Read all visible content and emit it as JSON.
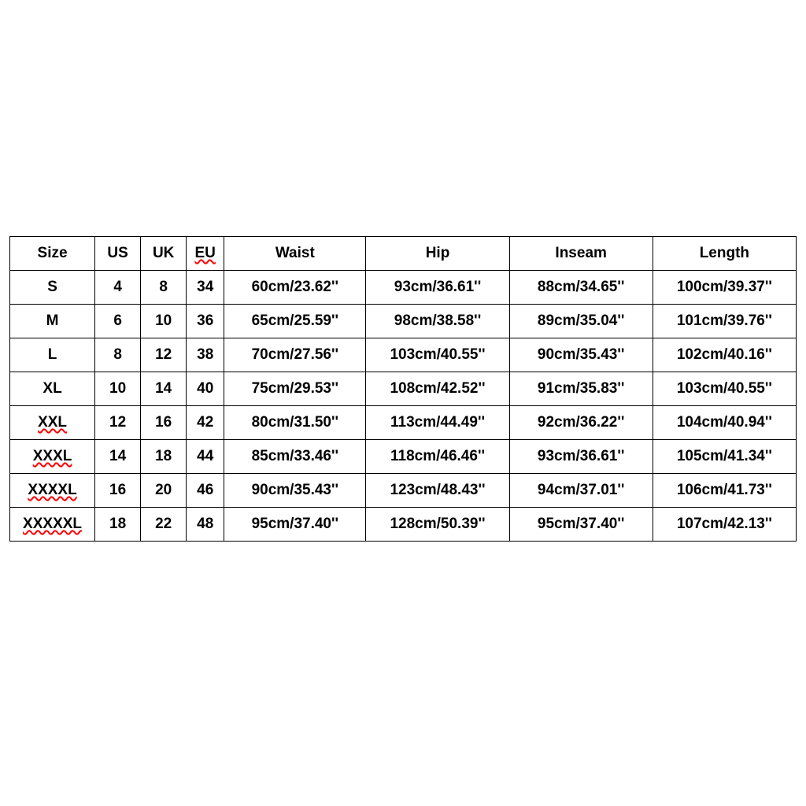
{
  "chart_data": {
    "type": "table",
    "columns": [
      "Size",
      "US",
      "UK",
      "EU",
      "Waist",
      "Hip",
      "Inseam",
      "Length"
    ],
    "rows": [
      [
        "S",
        "4",
        "8",
        "34",
        "60cm/23.62''",
        "93cm/36.61''",
        "88cm/34.65''",
        "100cm/39.37''"
      ],
      [
        "M",
        "6",
        "10",
        "36",
        "65cm/25.59''",
        "98cm/38.58''",
        "89cm/35.04''",
        "101cm/39.76''"
      ],
      [
        "L",
        "8",
        "12",
        "38",
        "70cm/27.56''",
        "103cm/40.55''",
        "90cm/35.43''",
        "102cm/40.16''"
      ],
      [
        "XL",
        "10",
        "14",
        "40",
        "75cm/29.53''",
        "108cm/42.52''",
        "91cm/35.83''",
        "103cm/40.55''"
      ],
      [
        "XXL",
        "12",
        "16",
        "42",
        "80cm/31.50''",
        "113cm/44.49''",
        "92cm/36.22''",
        "104cm/40.94''"
      ],
      [
        "XXXL",
        "14",
        "18",
        "44",
        "85cm/33.46''",
        "118cm/46.46''",
        "93cm/36.61''",
        "105cm/41.34''"
      ],
      [
        "XXXXL",
        "16",
        "20",
        "46",
        "90cm/35.43''",
        "123cm/48.43''",
        "94cm/37.01''",
        "106cm/41.73''"
      ],
      [
        "XXXXXL",
        "18",
        "22",
        "48",
        "95cm/37.40''",
        "128cm/50.39''",
        "95cm/37.40''",
        "107cm/42.13''"
      ]
    ]
  },
  "headers": {
    "size": {
      "label": "Size",
      "squiggle": false
    },
    "us": {
      "label": "US",
      "squiggle": false
    },
    "uk": {
      "label": "UK",
      "squiggle": false
    },
    "eu": {
      "label": "EU",
      "squiggle": true
    },
    "waist": {
      "label": "Waist",
      "squiggle": false
    },
    "hip": {
      "label": "Hip",
      "squiggle": false
    },
    "inseam": {
      "label": "Inseam",
      "squiggle": false
    },
    "length": {
      "label": "Length",
      "squiggle": false
    }
  },
  "rows": [
    {
      "size": {
        "v": "S",
        "sq": false
      },
      "us": "4",
      "uk": "8",
      "eu": "34",
      "waist": "60cm/23.62''",
      "hip": "93cm/36.61''",
      "inseam": "88cm/34.65''",
      "length": "100cm/39.37''"
    },
    {
      "size": {
        "v": "M",
        "sq": false
      },
      "us": "6",
      "uk": "10",
      "eu": "36",
      "waist": "65cm/25.59''",
      "hip": "98cm/38.58''",
      "inseam": "89cm/35.04''",
      "length": "101cm/39.76''"
    },
    {
      "size": {
        "v": "L",
        "sq": false
      },
      "us": "8",
      "uk": "12",
      "eu": "38",
      "waist": "70cm/27.56''",
      "hip": "103cm/40.55''",
      "inseam": "90cm/35.43''",
      "length": "102cm/40.16''"
    },
    {
      "size": {
        "v": "XL",
        "sq": false
      },
      "us": "10",
      "uk": "14",
      "eu": "40",
      "waist": "75cm/29.53''",
      "hip": "108cm/42.52''",
      "inseam": "91cm/35.83''",
      "length": "103cm/40.55''"
    },
    {
      "size": {
        "v": "XXL",
        "sq": true
      },
      "us": "12",
      "uk": "16",
      "eu": "42",
      "waist": "80cm/31.50''",
      "hip": "113cm/44.49''",
      "inseam": "92cm/36.22''",
      "length": "104cm/40.94''"
    },
    {
      "size": {
        "v": "XXXL",
        "sq": true
      },
      "us": "14",
      "uk": "18",
      "eu": "44",
      "waist": "85cm/33.46''",
      "hip": "118cm/46.46''",
      "inseam": "93cm/36.61''",
      "length": "105cm/41.34''"
    },
    {
      "size": {
        "v": "XXXXL",
        "sq": true
      },
      "us": "16",
      "uk": "20",
      "eu": "46",
      "waist": "90cm/35.43''",
      "hip": "123cm/48.43''",
      "inseam": "94cm/37.01''",
      "length": "106cm/41.73''"
    },
    {
      "size": {
        "v": "XXXXXL",
        "sq": true
      },
      "us": "18",
      "uk": "22",
      "eu": "48",
      "waist": "95cm/37.40''",
      "hip": "128cm/50.39''",
      "inseam": "95cm/37.40''",
      "length": "107cm/42.13''"
    }
  ]
}
